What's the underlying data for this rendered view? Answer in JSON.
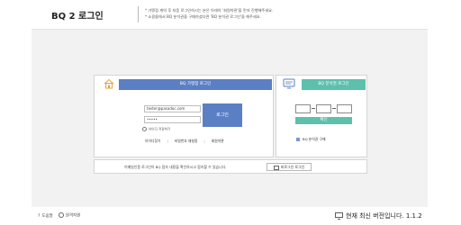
{
  "header": {
    "title": "BQ 2 로그인",
    "notice_line1": "* 가맹점 계약 후 처음 로그인하시는 분은 아래의 '회원약관'을 먼저 진행해주세요.",
    "notice_line2": "* 쇼핑몰에서 BQ 분석권을 구매하셨다면 'BQ 분석권 로그인'을 해주세요."
  },
  "merchant_login": {
    "header_label": "BQ 가맹점 로그인",
    "id_value": "tester@pasadoc.com",
    "password_value": "•••••",
    "login_button": "로그인",
    "save_id_label": "아이디 저장하기",
    "link_find_id": "아이디찾기",
    "link_reset_password": "비밀번호 재설정",
    "link_terms": "회원약관"
  },
  "analyst_login": {
    "header_label": "BQ 분석권 로그인",
    "confirm_button": "확인",
    "buy_label": "BQ 분석권 구매"
  },
  "guide": {
    "text": "이메일인증 로그인이 BQ 접속 내용을 확인하시고 접속할 수 있습니다.",
    "button": "비로그인 로그인"
  },
  "footer": {
    "help_label": "도움말",
    "support_label": "원격지원",
    "version_text": "현재 최신 버전입니다. 1.1.2"
  }
}
